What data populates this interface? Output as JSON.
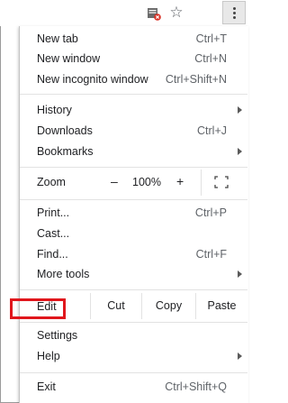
{
  "toolbar": {
    "extension_icon": "blocked-page-icon",
    "bookmark_icon": "star-outline-icon",
    "menu_icon": "three-dot-menu-icon"
  },
  "menu": {
    "new_tab": {
      "label": "New tab",
      "shortcut": "Ctrl+T"
    },
    "new_window": {
      "label": "New window",
      "shortcut": "Ctrl+N"
    },
    "new_incognito": {
      "label": "New incognito window",
      "shortcut": "Ctrl+Shift+N"
    },
    "history": {
      "label": "History"
    },
    "downloads": {
      "label": "Downloads",
      "shortcut": "Ctrl+J"
    },
    "bookmarks": {
      "label": "Bookmarks"
    },
    "zoom": {
      "label": "Zoom",
      "minus": "–",
      "value": "100%",
      "plus": "+"
    },
    "print": {
      "label": "Print...",
      "shortcut": "Ctrl+P"
    },
    "cast": {
      "label": "Cast..."
    },
    "find": {
      "label": "Find...",
      "shortcut": "Ctrl+F"
    },
    "more_tools": {
      "label": "More tools"
    },
    "edit": {
      "label": "Edit",
      "cut": "Cut",
      "copy": "Copy",
      "paste": "Paste"
    },
    "settings": {
      "label": "Settings"
    },
    "help": {
      "label": "Help"
    },
    "exit": {
      "label": "Exit",
      "shortcut": "Ctrl+Shift+Q"
    }
  },
  "colors": {
    "highlight": "#e0161c",
    "text": "#202124",
    "shortcut_text": "#5f6368"
  }
}
